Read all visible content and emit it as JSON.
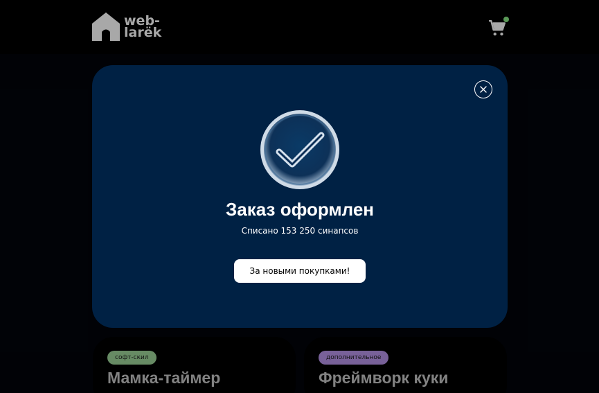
{
  "header": {
    "logo_line1": "web-",
    "logo_line2": "larёk",
    "cart_count": "0"
  },
  "catalog": {
    "cards": [
      {
        "category": "софт-скил",
        "title": "Мамка-таймер"
      },
      {
        "category": "дополнительное",
        "title": "Фреймворк куки"
      }
    ]
  },
  "modal": {
    "title": "Заказ оформлен",
    "description": "Списано 153 250 синапсов",
    "button_label": "За новыми покупками!"
  },
  "colors": {
    "modal_bg": "#002144",
    "tag_soft": "#9ed69a",
    "tag_extra": "#b896ec",
    "page_bg": "#000000"
  },
  "icons": [
    "house-icon",
    "cart-icon",
    "close-icon",
    "checkmark-icon"
  ]
}
